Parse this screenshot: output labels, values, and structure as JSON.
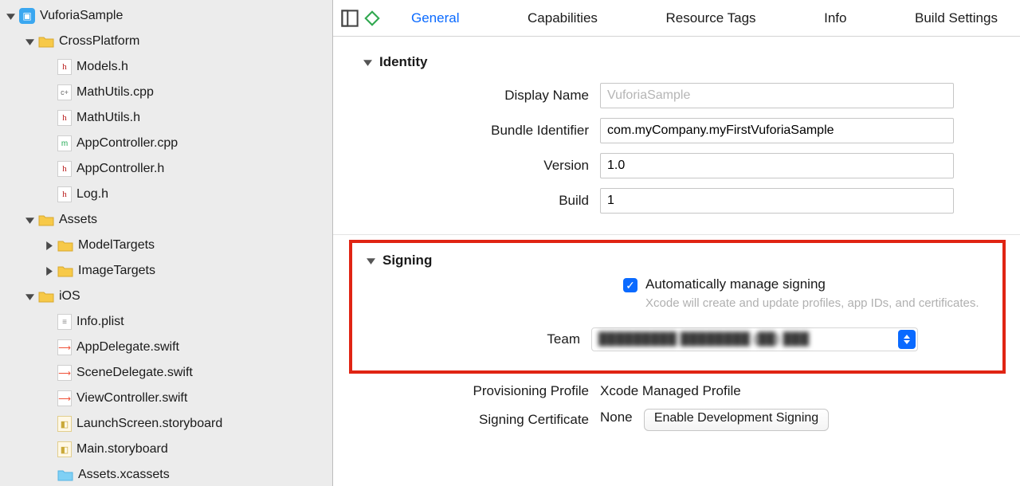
{
  "sidebar": {
    "rows": [
      {
        "depth": 0,
        "disclosure": "down",
        "icon": "project",
        "label": "VuforiaSample"
      },
      {
        "depth": 1,
        "disclosure": "down",
        "icon": "folder",
        "label": "CrossPlatform"
      },
      {
        "depth": 2,
        "disclosure": "none",
        "icon": "h",
        "label": "Models.h"
      },
      {
        "depth": 2,
        "disclosure": "none",
        "icon": "cpp",
        "label": "MathUtils.cpp"
      },
      {
        "depth": 2,
        "disclosure": "none",
        "icon": "h",
        "label": "MathUtils.h"
      },
      {
        "depth": 2,
        "disclosure": "none",
        "icon": "m",
        "label": "AppController.cpp"
      },
      {
        "depth": 2,
        "disclosure": "none",
        "icon": "h",
        "label": "AppController.h"
      },
      {
        "depth": 2,
        "disclosure": "none",
        "icon": "h",
        "label": "Log.h"
      },
      {
        "depth": 1,
        "disclosure": "down",
        "icon": "folder",
        "label": "Assets"
      },
      {
        "depth": 2,
        "disclosure": "right",
        "icon": "folder",
        "label": "ModelTargets"
      },
      {
        "depth": 2,
        "disclosure": "right",
        "icon": "folder",
        "label": "ImageTargets"
      },
      {
        "depth": 1,
        "disclosure": "down",
        "icon": "folder",
        "label": "iOS"
      },
      {
        "depth": 2,
        "disclosure": "none",
        "icon": "plist",
        "label": "Info.plist"
      },
      {
        "depth": 2,
        "disclosure": "none",
        "icon": "swift",
        "label": "AppDelegate.swift"
      },
      {
        "depth": 2,
        "disclosure": "none",
        "icon": "swift",
        "label": "SceneDelegate.swift"
      },
      {
        "depth": 2,
        "disclosure": "none",
        "icon": "swift",
        "label": "ViewController.swift"
      },
      {
        "depth": 2,
        "disclosure": "none",
        "icon": "story",
        "label": "LaunchScreen.storyboard"
      },
      {
        "depth": 2,
        "disclosure": "none",
        "icon": "story",
        "label": "Main.storyboard"
      },
      {
        "depth": 2,
        "disclosure": "none",
        "icon": "folderblue",
        "label": "Assets.xcassets"
      }
    ]
  },
  "tabs": {
    "items": [
      "General",
      "Capabilities",
      "Resource Tags",
      "Info",
      "Build Settings"
    ],
    "active_index": 0
  },
  "sections": {
    "identity": {
      "title": "Identity",
      "display_name_label": "Display Name",
      "display_name_placeholder": "VuforiaSample",
      "display_name_value": "",
      "bundle_id_label": "Bundle Identifier",
      "bundle_id_value": "com.myCompany.myFirstVuforiaSample",
      "version_label": "Version",
      "version_value": "1.0",
      "build_label": "Build",
      "build_value": "1"
    },
    "signing": {
      "title": "Signing",
      "auto_label": "Automatically manage signing",
      "auto_checked": true,
      "auto_hint": "Xcode will create and update profiles, app IDs, and certificates.",
      "team_label": "Team",
      "team_value_obscured": "█████████ ████████ (██) ███",
      "prov_label": "Provisioning Profile",
      "prov_value": "Xcode Managed Profile",
      "cert_label": "Signing Certificate",
      "cert_value": "None",
      "enable_button": "Enable Development Signing"
    }
  }
}
